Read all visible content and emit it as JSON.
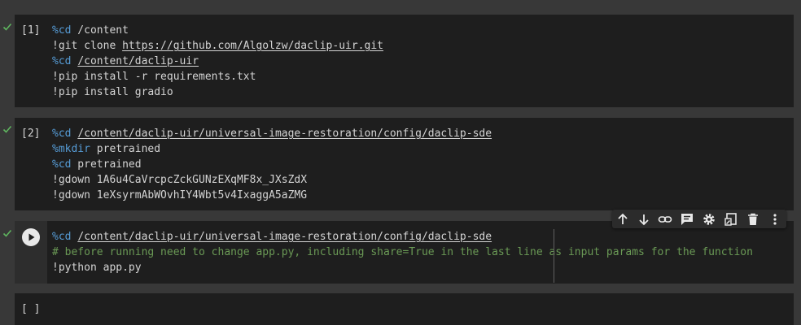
{
  "cells": [
    {
      "prompt": "[1]",
      "lines": [
        {
          "parts": [
            {
              "t": "%cd",
              "k": "magic"
            },
            {
              "t": " /content",
              "k": "plain"
            }
          ]
        },
        {
          "parts": [
            {
              "t": "!git clone ",
              "k": "plain"
            },
            {
              "t": "https://github.com/Algolzw/daclip-uir.git",
              "k": "link"
            }
          ]
        },
        {
          "parts": [
            {
              "t": "%cd",
              "k": "magic"
            },
            {
              "t": " ",
              "k": "plain"
            },
            {
              "t": "/content/daclip-uir",
              "k": "link"
            }
          ]
        },
        {
          "parts": [
            {
              "t": "!pip install -r requirements.txt",
              "k": "plain"
            }
          ]
        },
        {
          "parts": [
            {
              "t": "!pip install gradio",
              "k": "plain"
            }
          ]
        }
      ]
    },
    {
      "prompt": "[2]",
      "lines": [
        {
          "parts": [
            {
              "t": "%cd",
              "k": "magic"
            },
            {
              "t": " ",
              "k": "plain"
            },
            {
              "t": "/content/daclip-uir/universal-image-restoration/config/daclip-sde",
              "k": "link"
            }
          ]
        },
        {
          "parts": [
            {
              "t": "%mkdir",
              "k": "magic"
            },
            {
              "t": " pretrained",
              "k": "plain"
            }
          ]
        },
        {
          "parts": [
            {
              "t": "%cd",
              "k": "magic"
            },
            {
              "t": " pretrained",
              "k": "plain"
            }
          ]
        },
        {
          "parts": [
            {
              "t": "!gdown 1A6u4CaVrcpcZckGUNzEXqMF8x_JXsZdX",
              "k": "plain"
            }
          ]
        },
        {
          "parts": [
            {
              "t": "!gdown 1eXsyrmAbWOvhIY4Wbt5v4IxaggA5aZMG",
              "k": "plain"
            }
          ]
        }
      ]
    },
    {
      "prompt": "",
      "lines": [
        {
          "parts": [
            {
              "t": "%cd",
              "k": "magic"
            },
            {
              "t": " ",
              "k": "plain"
            },
            {
              "t": "/content/daclip-uir/universal-image-restoration/config/daclip-sde",
              "k": "link"
            }
          ]
        },
        {
          "parts": [
            {
              "t": "# before running need to change app.py, including share=True in the last line as input params for the function",
              "k": "comment"
            }
          ]
        },
        {
          "parts": [
            {
              "t": "!python app.py",
              "k": "plain"
            }
          ]
        }
      ]
    },
    {
      "prompt": "[ ]",
      "lines": []
    }
  ],
  "toolbar_icons": [
    "move-up-icon",
    "move-down-icon",
    "link-icon",
    "comment-icon",
    "settings-icon",
    "editor-icon",
    "delete-icon",
    "more-icon"
  ],
  "colors": {
    "background": "#383838",
    "cell": "#1e1e1e",
    "magic": "#569cd6",
    "comment": "#6a9955",
    "check": "#5fb65f"
  }
}
